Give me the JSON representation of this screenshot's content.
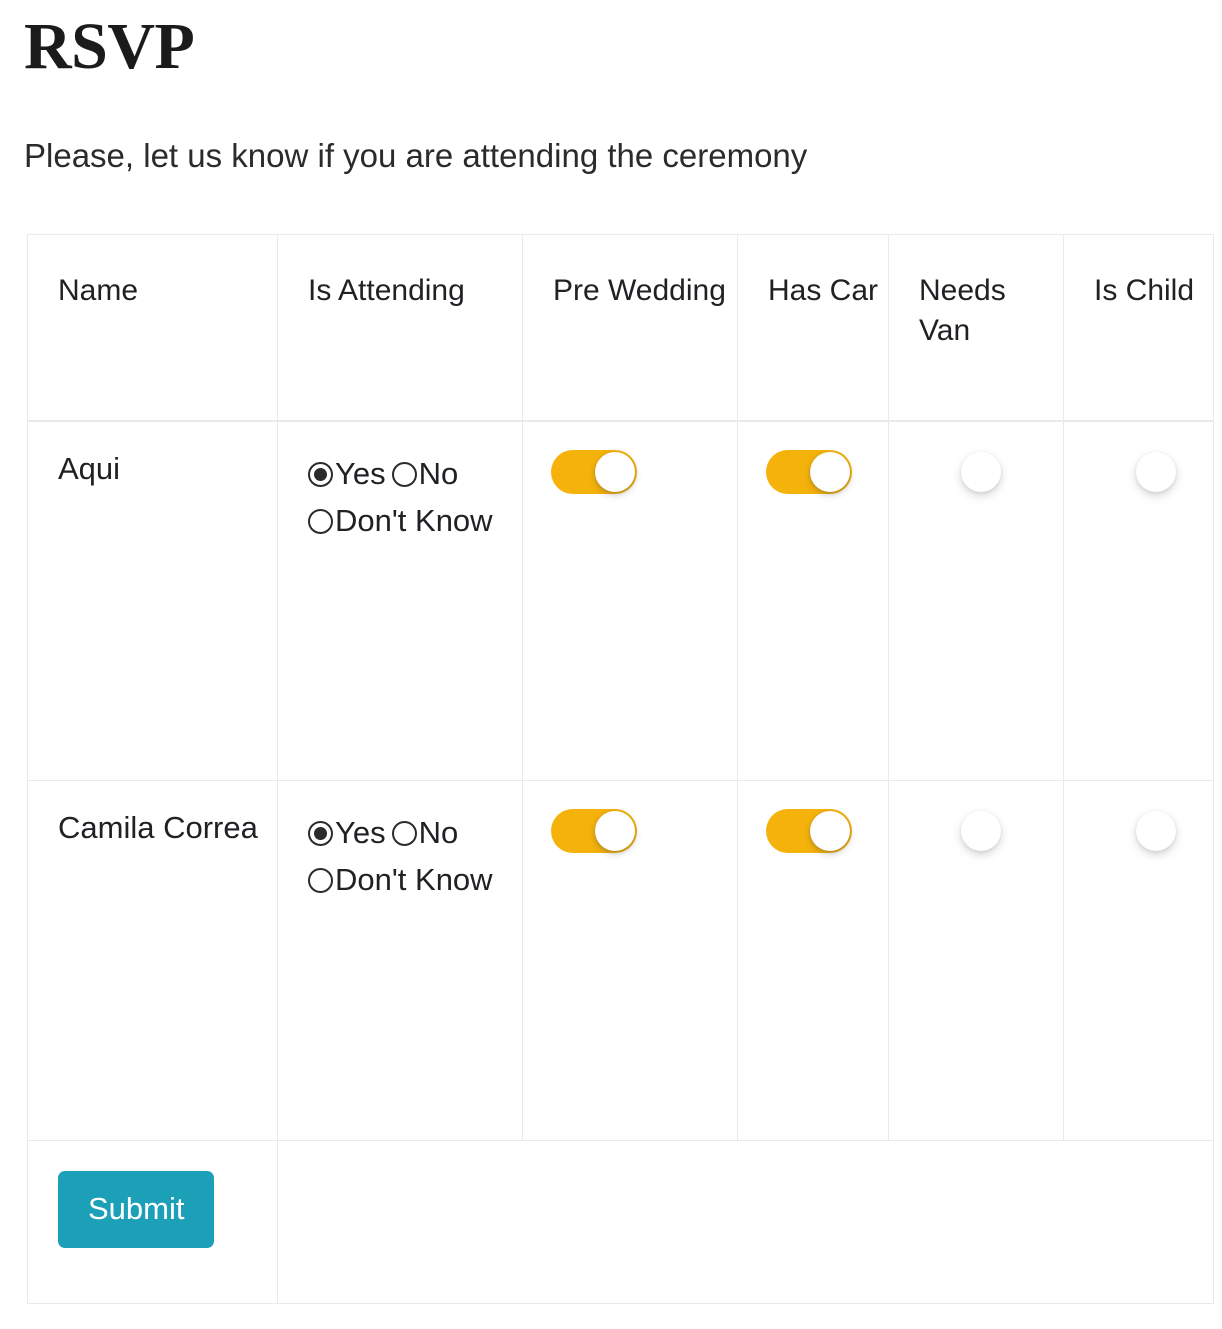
{
  "page": {
    "title": "RSVP",
    "subtitle": "Please, let us know if you are attending the ceremony"
  },
  "colors": {
    "toggle_on": "#F5B20B",
    "submit_button": "#1CA0B8",
    "table_border": "#E8EAED",
    "text": "#202124"
  },
  "table": {
    "headers": [
      "Name",
      "Is Attending",
      "Pre Wedding",
      "Has Car",
      "Needs Van",
      "Is Child"
    ],
    "attending_options": [
      "Yes",
      "No",
      "Don't Know"
    ],
    "rows": [
      {
        "name": "Aqui",
        "is_attending": "Yes",
        "pre_wedding": "on",
        "has_car": "on",
        "needs_van": "off",
        "is_child": "off"
      },
      {
        "name": "Camila Correa",
        "is_attending": "Yes",
        "pre_wedding": "on",
        "has_car": "on",
        "needs_van": "off",
        "is_child": "off"
      }
    ]
  },
  "actions": {
    "submit_label": "Submit"
  }
}
